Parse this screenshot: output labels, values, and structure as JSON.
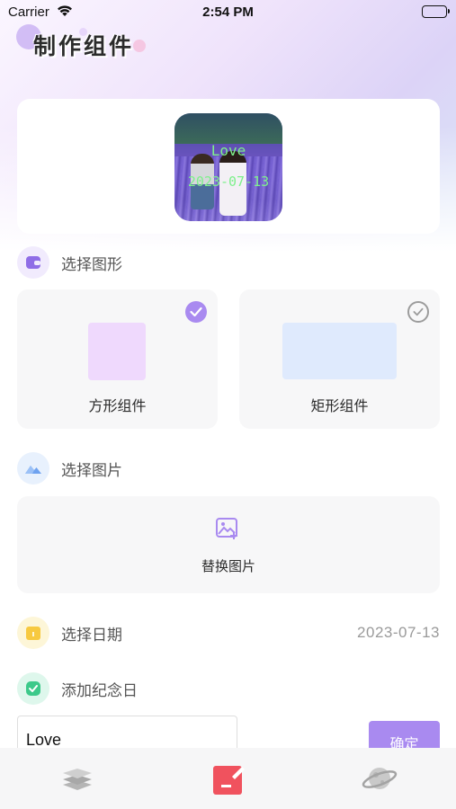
{
  "status_bar": {
    "carrier": "Carrier",
    "time": "2:54 PM"
  },
  "page": {
    "title": "制作组件"
  },
  "preview": {
    "overlay_text": "Love",
    "overlay_date": "2023-07-13",
    "overlay_color": "#7ef08c"
  },
  "shape_section": {
    "label": "选择图形",
    "icon": "widget-icon",
    "options": [
      {
        "label": "方形组件",
        "selected": true,
        "swatch_color": "#efd9fd"
      },
      {
        "label": "矩形组件",
        "selected": false,
        "swatch_color": "#dfeafd"
      }
    ]
  },
  "image_section": {
    "label": "选择图片",
    "icon": "mountain-image-icon",
    "replace_label": "替换图片"
  },
  "date_section": {
    "label": "选择日期",
    "icon": "calendar-icon",
    "value": "2023-07-13"
  },
  "anniversary_section": {
    "label": "添加纪念日",
    "icon": "check-icon",
    "input_value": "Love",
    "confirm_label": "确定"
  },
  "tab_bar": {
    "tabs": [
      {
        "name": "layers-icon",
        "active": false
      },
      {
        "name": "edit-icon",
        "active": true
      },
      {
        "name": "planet-icon",
        "active": false
      }
    ]
  },
  "colors": {
    "accent": "#a98af0",
    "active_tab": "#f0525e"
  }
}
